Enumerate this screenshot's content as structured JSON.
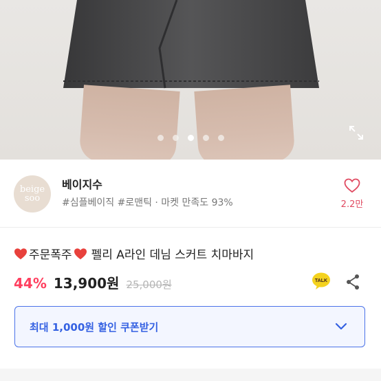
{
  "image": {
    "carousel": {
      "dot_count": 5,
      "active_index": 2
    },
    "expand_icon": "expand-icon"
  },
  "shop": {
    "logo_line1": "beige",
    "logo_line2": "soo",
    "name": "베이지수",
    "tags": "#심플베이직 #로맨틱 · 마켓 만족도 93%",
    "like_count": "2.2만"
  },
  "product": {
    "title": "주문폭주",
    "name": "펠리 A라인 데님 스커트 치마바지",
    "discount": "44%",
    "price": "13,900원",
    "original_price": "25,000원"
  },
  "coupon": {
    "label": "최대 1,000원 할인 쿠폰받기"
  },
  "colors": {
    "accent_pink": "#ff3f5f",
    "coupon_blue": "#3461e2",
    "talk_yellow": "#f4d21f"
  }
}
